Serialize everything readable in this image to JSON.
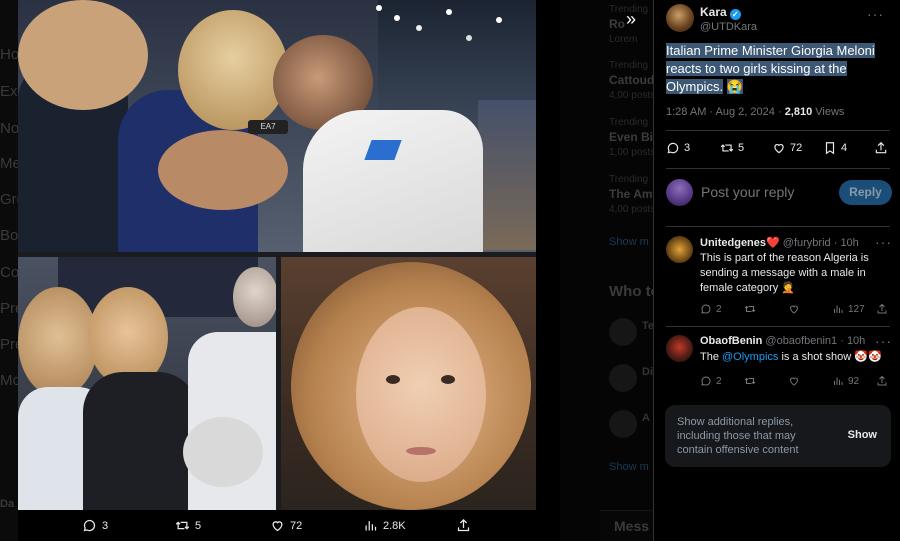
{
  "background": {
    "nav_items": [
      "Ho",
      "Exp",
      "No",
      "Me",
      "Gro",
      "Bo",
      "Co",
      "Pre",
      "Pre",
      "Mo"
    ],
    "left_user": "Da",
    "trends": [
      {
        "cat": "Trending",
        "name": "Ro",
        "count": "Lorem"
      },
      {
        "cat": "Trending",
        "name": "Cattoud",
        "count": "4,00 posts"
      },
      {
        "cat": "Trending",
        "name": "Even Bid",
        "count": "1,00 posts"
      },
      {
        "cat": "Trending",
        "name": "The Ame",
        "count": "4,00 posts"
      }
    ],
    "show_more_1": "Show m",
    "who_to_follow": "Who to",
    "follow_suggestions": [
      "Te",
      "Di",
      "A"
    ],
    "show_more_2": "Show m",
    "messages_dock": "Mess"
  },
  "media": {
    "actions": {
      "reply_count": "3",
      "retweet_count": "5",
      "like_count": "72",
      "views_count": "2.8K"
    },
    "top_photo_watermark": "EA7"
  },
  "tweet": {
    "author": {
      "name": "Kara",
      "handle": "@UTDKara",
      "verified": true
    },
    "text": "Italian Prime Minister Giorgia Meloni reacts to two girls kissing at the Olympics.",
    "emoji": "😭",
    "time": "1:28 AM",
    "date": "Aug 2, 2024",
    "views": "2,810",
    "views_label": "Views",
    "stats": {
      "replies": "3",
      "retweets": "5",
      "likes": "72",
      "bookmarks": "4"
    }
  },
  "composer": {
    "placeholder": "Post your reply",
    "button": "Reply"
  },
  "replies": [
    {
      "name": "Unitedgenes",
      "name_emoji": "❤️",
      "handle": "@furybrid",
      "time": "10h",
      "text": "This is part of the reason Algeria is sending a message with a male in female category",
      "text_emoji": "🤦",
      "stats": {
        "replies": "2",
        "retweets": "",
        "likes": "",
        "views": "127"
      }
    },
    {
      "name": "ObaofBenin",
      "handle": "@obaofbenin1",
      "time": "10h",
      "text_prefix": "The ",
      "mention": "@Olympics",
      "text_suffix": " is a shot show",
      "text_emoji": "🤡🤡",
      "stats": {
        "replies": "2",
        "retweets": "",
        "likes": "",
        "views": "92"
      }
    }
  ],
  "additional_replies": {
    "text": "Show additional replies, including those that may contain offensive content",
    "button": "Show"
  },
  "colors": {
    "accent": "#1d9bf0",
    "highlight": "#3d5875",
    "muted": "#71767b",
    "divider": "#2f3336"
  }
}
